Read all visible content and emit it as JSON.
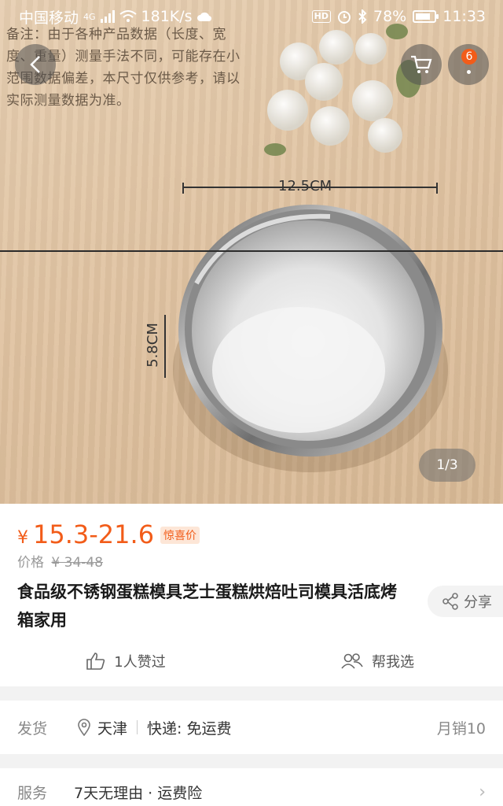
{
  "status_bar": {
    "carrier": "中国移动",
    "network": "4G",
    "speed": "181K/s",
    "hd": "HD",
    "battery": "78%",
    "time": "11:33"
  },
  "hero": {
    "note_text": "备注：由于各种产品数据（长度、宽度、重量）测量手法不同，可能存在小范围数据偏差，本尺寸仅供参考，请以实际测量数据为准。",
    "width_label": "12.5CM",
    "height_label": "5.8CM",
    "pager": "1/3",
    "more_badge": "6"
  },
  "product": {
    "currency": "¥",
    "price": "15.3-21.6",
    "price_tag": "惊喜价",
    "original_label": "价格",
    "original_price": "¥ 34-48",
    "title": "食品级不锈钢蛋糕模具芝士蛋糕烘焙吐司模具活底烤箱家用",
    "share_label": "分享",
    "likes_label": "1人赞过",
    "help_choose_label": "帮我选"
  },
  "shipping": {
    "label": "发货",
    "location": "天津",
    "delivery": "快递: 免运费",
    "monthly_sales": "月销10"
  },
  "service": {
    "label": "服务",
    "text": "7天无理由 · 运费险"
  },
  "colors": {
    "accent": "#f25c19",
    "tag_bg": "#fde6d7",
    "page_bg": "#f2f2f2"
  }
}
